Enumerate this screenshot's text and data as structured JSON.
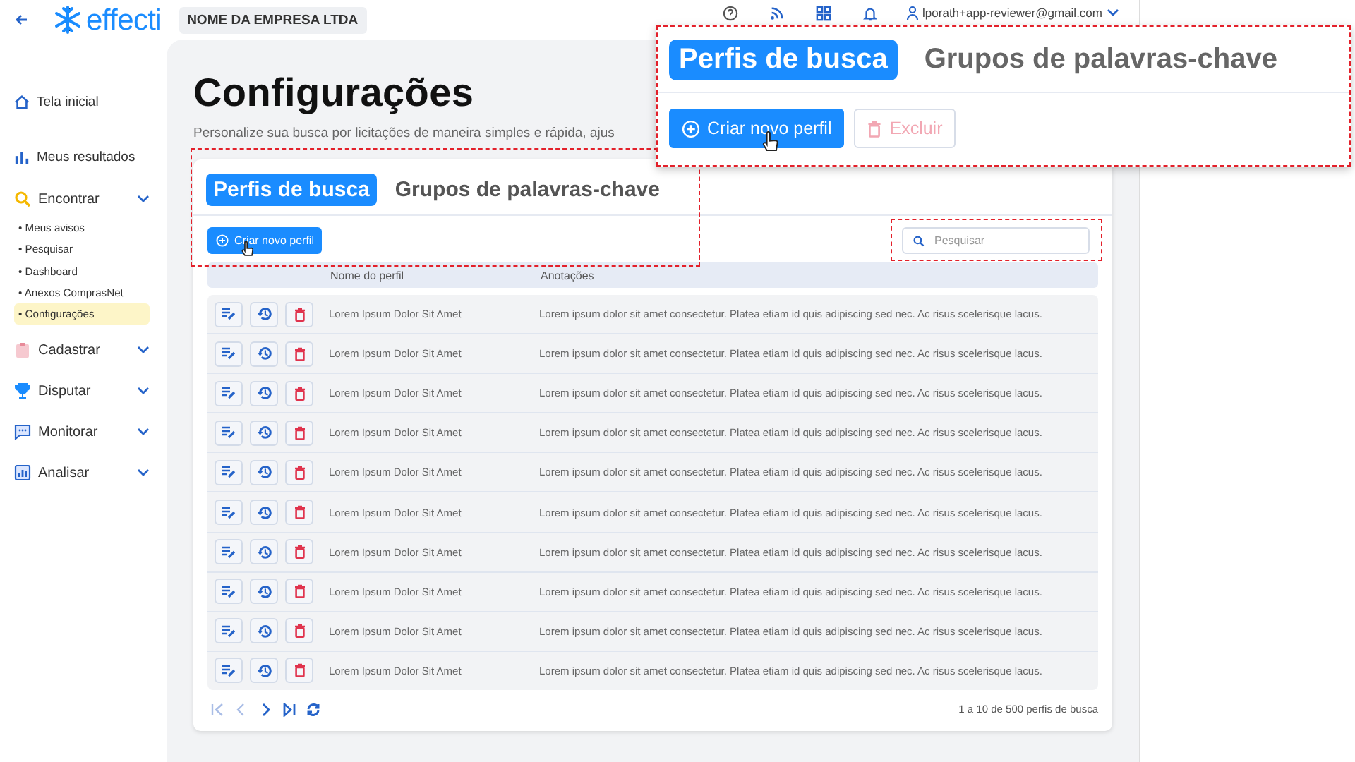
{
  "header": {
    "logo": "effecti",
    "company": "NOME DA EMPRESA LTDA",
    "user_email": "lporath+app-reviewer@gmail.com"
  },
  "sidebar": {
    "items": [
      {
        "label": "Tela inicial",
        "kind": "link"
      },
      {
        "label": "Meus resultados",
        "kind": "link"
      },
      {
        "label": "Encontrar",
        "kind": "group",
        "expanded": true,
        "children": [
          {
            "label": "• Meus avisos",
            "selected": false
          },
          {
            "label": "• Pesquisar",
            "selected": false
          },
          {
            "label": "• Dashboard",
            "selected": false
          },
          {
            "label": "• Anexos ComprasNet",
            "selected": false
          },
          {
            "label": "• Configurações",
            "selected": true
          }
        ]
      },
      {
        "label": "Cadastrar",
        "kind": "group",
        "expanded": false
      },
      {
        "label": "Disputar",
        "kind": "group",
        "expanded": false
      },
      {
        "label": "Monitorar",
        "kind": "group",
        "expanded": false
      },
      {
        "label": "Analisar",
        "kind": "group",
        "expanded": false
      }
    ]
  },
  "page": {
    "title": "Configurações",
    "subtitle": "Personalize sua busca por licitações de maneira simples e rápida, ajus"
  },
  "tabs": [
    {
      "label": "Perfis de busca",
      "selected": true
    },
    {
      "label": "Grupos de palavras-chave",
      "selected": false
    }
  ],
  "create_button": "Criar novo perfil",
  "search": {
    "placeholder": "Pesquisar"
  },
  "table": {
    "columns": [
      "Nome do perfil",
      "Anotações"
    ],
    "rows": [
      {
        "name": "Lorem Ipsum Dolor Sit Amet",
        "notes": "Lorem ipsum dolor sit amet consectetur. Platea etiam id quis adipiscing sed nec. Ac risus scelerisque lacus."
      },
      {
        "name": "Lorem Ipsum Dolor Sit Amet",
        "notes": "Lorem ipsum dolor sit amet consectetur. Platea etiam id quis adipiscing sed nec. Ac risus scelerisque lacus."
      },
      {
        "name": "Lorem Ipsum Dolor Sit Amet",
        "notes": "Lorem ipsum dolor sit amet consectetur. Platea etiam id quis adipiscing sed nec. Ac risus scelerisque lacus."
      },
      {
        "name": "Lorem Ipsum Dolor Sit Amet",
        "notes": "Lorem ipsum dolor sit amet consectetur. Platea etiam id quis adipiscing sed nec. Ac risus scelerisque lacus."
      },
      {
        "name": "Lorem Ipsum Dolor Sit Amet",
        "notes": "Lorem ipsum dolor sit amet consectetur. Platea etiam id quis adipiscing sed nec. Ac risus scelerisque lacus."
      },
      {
        "name": "Lorem Ipsum Dolor Sit Amet",
        "notes": "Lorem ipsum dolor sit amet consectetur. Platea etiam id quis adipiscing sed nec. Ac risus scelerisque lacus."
      },
      {
        "name": "Lorem Ipsum Dolor Sit Amet",
        "notes": "Lorem ipsum dolor sit amet consectetur. Platea etiam id quis adipiscing sed nec. Ac risus scelerisque lacus."
      },
      {
        "name": "Lorem Ipsum Dolor Sit Amet",
        "notes": "Lorem ipsum dolor sit amet consectetur. Platea etiam id quis adipiscing sed nec. Ac risus scelerisque lacus."
      },
      {
        "name": "Lorem Ipsum Dolor Sit Amet",
        "notes": "Lorem ipsum dolor sit amet consectetur. Platea etiam id quis adipiscing sed nec. Ac risus scelerisque lacus."
      },
      {
        "name": "Lorem Ipsum Dolor Sit Amet",
        "notes": "Lorem ipsum dolor sit amet consectetur. Platea etiam id quis adipiscing sed nec. Ac risus scelerisque lacus."
      }
    ]
  },
  "pagination": {
    "buttons": [
      {
        "disabled": true
      },
      {
        "disabled": true
      },
      {
        "disabled": false
      },
      {
        "disabled": false
      },
      {
        "disabled": false
      }
    ],
    "summary": "1 a 10 de 500 perfis de busca"
  },
  "callout": {
    "tabs": [
      {
        "label": "Perfis de busca",
        "selected": true
      },
      {
        "label": "Grupos de palavras-chave",
        "selected": false
      }
    ],
    "buttons": [
      {
        "label": "Criar novo perfil",
        "kind": "create",
        "disabled": false
      },
      {
        "label": "Excluir",
        "kind": "delete",
        "disabled": true
      }
    ]
  }
}
